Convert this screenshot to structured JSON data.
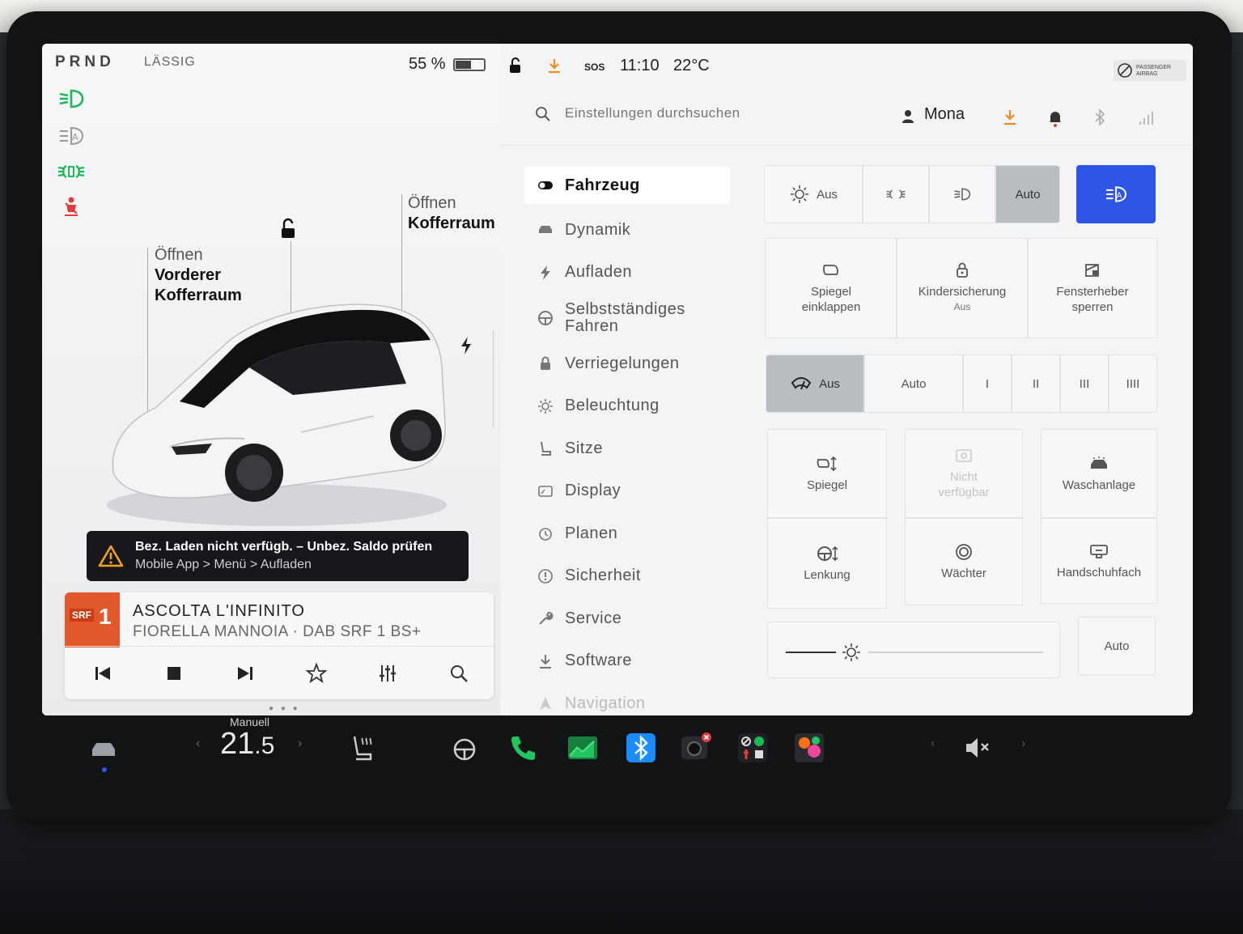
{
  "car_panel": {
    "gear": "PRND",
    "drive_mode": "LÄSSIG",
    "battery_pct": "55 %",
    "battery_level": 0.55,
    "front_trunk": {
      "line1": "Öffnen",
      "line2": "Vorderer",
      "line3": "Kofferraum"
    },
    "rear_trunk": {
      "line1": "Öffnen",
      "line2": "Kofferraum"
    },
    "warning": {
      "title": "Bez. Laden nicht verfügb. – Unbez. Saldo prüfen",
      "subtitle": "Mobile App > Menü > Aufladen"
    },
    "media": {
      "logo_text": "SRF",
      "logo_number": "1",
      "title": "ASCOLTA L'INFINITO",
      "subtitle": "FIORELLA MANNOIA · DAB SRF 1 BS+"
    }
  },
  "status": {
    "sos": "SOS",
    "time": "11:10",
    "temp": "22°C",
    "airbag": "PASSENGER AIRBAG"
  },
  "search": {
    "placeholder": "Einstellungen durchsuchen"
  },
  "profile": {
    "name": "Mona"
  },
  "nav": [
    {
      "label": "Fahrzeug",
      "icon": "toggle-icon"
    },
    {
      "label": "Dynamik",
      "icon": "car-icon"
    },
    {
      "label": "Aufladen",
      "icon": "bolt-icon"
    },
    {
      "label": "Selbstständiges Fahren",
      "icon": "steering-wheel-icon"
    },
    {
      "label": "Verriegelungen",
      "icon": "lock-icon"
    },
    {
      "label": "Beleuchtung",
      "icon": "sun-icon"
    },
    {
      "label": "Sitze",
      "icon": "seat-icon"
    },
    {
      "label": "Display",
      "icon": "display-icon"
    },
    {
      "label": "Planen",
      "icon": "clock-icon"
    },
    {
      "label": "Sicherheit",
      "icon": "info-icon"
    },
    {
      "label": "Service",
      "icon": "wrench-icon"
    },
    {
      "label": "Software",
      "icon": "download-icon"
    },
    {
      "label": "Navigation",
      "icon": "navigation-icon"
    }
  ],
  "lights": {
    "off": "Aus",
    "auto": "Auto"
  },
  "controls": {
    "fold_mirrors": "Spiegel einklappen",
    "child_lock": "Kindersicherung",
    "child_lock_state": "Aus",
    "window_lock": "Fensterheber sperren",
    "wipers_off": "Aus",
    "wipers_auto": "Auto",
    "wiper_speeds": [
      "I",
      "II",
      "III",
      "IIII"
    ],
    "mirrors": "Spiegel",
    "unavailable": "Nicht verfügbar",
    "car_wash": "Waschanlage",
    "steering": "Lenkung",
    "sentry": "Wächter",
    "glovebox": "Handschuhfach",
    "brightness_auto": "Auto",
    "brightness_level": 0.07
  },
  "dock": {
    "temp_label": "Manuell",
    "temp_whole": "21",
    "temp_decimal": ".5"
  },
  "colors": {
    "accent_blue": "#2f55e6",
    "light_green": "#1fb55a",
    "seatbelt_red": "#e23b3b",
    "download_orange": "#f28a1c"
  }
}
